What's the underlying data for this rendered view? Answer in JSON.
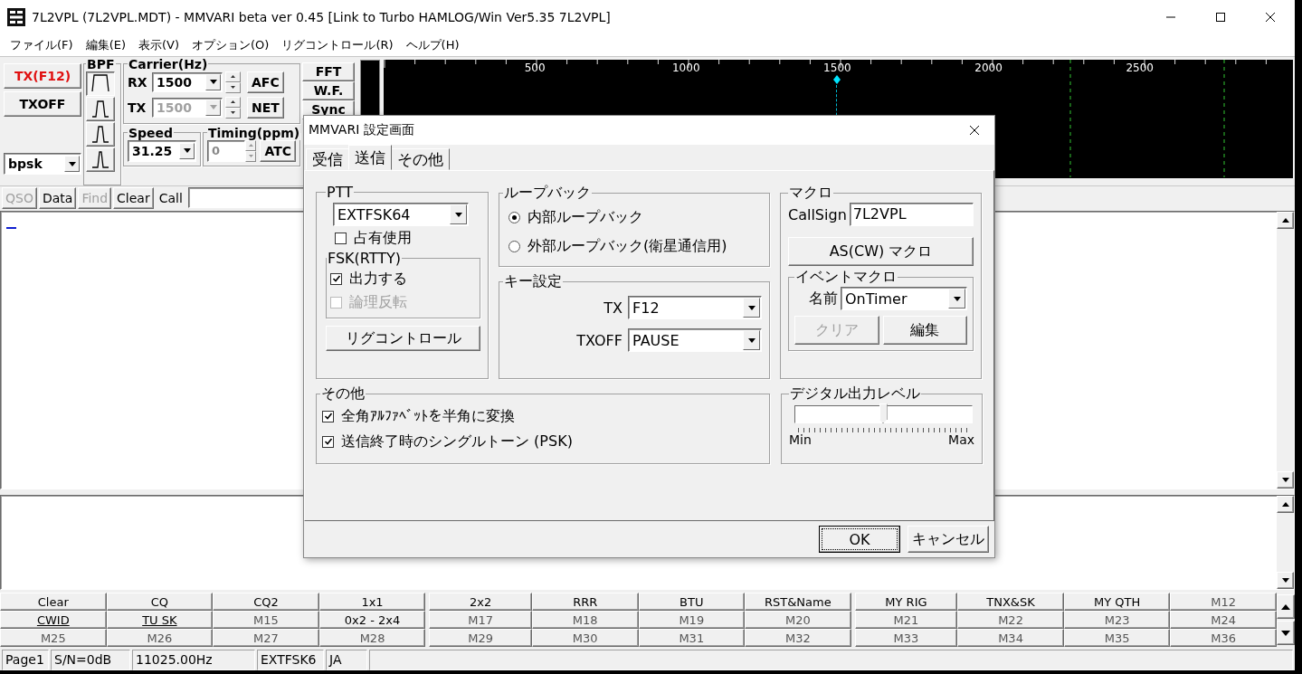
{
  "window": {
    "title": "7L2VPL (7L2VPL.MDT) - MMVARI beta ver 0.45 [Link to Turbo HAMLOG/Win Ver5.35 7L2VPL]"
  },
  "menu": [
    "ファイル(F)",
    "編集(E)",
    "表示(V)",
    "オプション(O)",
    "リグコントロール(R)",
    "ヘルプ(H)"
  ],
  "transmit": {
    "tx_button": "TX(F12)",
    "txoff_button": "TXOFF",
    "mode": "bpsk"
  },
  "bpf": {
    "label": "BPF",
    "filters": [
      {
        "selected": true
      },
      {
        "selected": false
      },
      {
        "selected": false
      },
      {
        "selected": false
      }
    ]
  },
  "carrier": {
    "label": "Carrier(Hz)",
    "rows": [
      {
        "label": "RX",
        "value": "1500",
        "disabled": false,
        "button": "AFC"
      },
      {
        "label": "TX",
        "value": "1500",
        "disabled": true,
        "button": "NET"
      }
    ]
  },
  "speed": {
    "label": "Speed",
    "value": "31.25"
  },
  "timing": {
    "label": "Timing(ppm)",
    "value": "0",
    "button": "ATC"
  },
  "view_buttons": [
    "FFT",
    "W.F.",
    "Sync"
  ],
  "spectrum": {
    "scale": [
      {
        "label": "500",
        "carrier": false
      },
      {
        "label": "1000",
        "carrier": false
      },
      {
        "label": "1500",
        "carrier": true
      },
      {
        "label": "2000",
        "carrier": false
      },
      {
        "label": "2500",
        "carrier": false
      }
    ]
  },
  "command_bar": {
    "buttons": [
      {
        "label": "QSO",
        "disabled": true
      },
      {
        "label": "Data",
        "disabled": false
      },
      {
        "label": "Find",
        "disabled": true
      },
      {
        "label": "Clear",
        "disabled": false
      }
    ],
    "call_label": "Call"
  },
  "macros": [
    {
      "label": "Clear",
      "assigned": true,
      "underlined": false
    },
    {
      "label": "CQ",
      "assigned": true,
      "underlined": false
    },
    {
      "label": "CQ2",
      "assigned": true,
      "underlined": false
    },
    {
      "label": "1x1",
      "assigned": true,
      "underlined": false
    },
    {
      "label": "2x2",
      "assigned": true,
      "underlined": false
    },
    {
      "label": "RRR",
      "assigned": true,
      "underlined": false
    },
    {
      "label": "BTU",
      "assigned": true,
      "underlined": false
    },
    {
      "label": "RST&Name",
      "assigned": true,
      "underlined": false
    },
    {
      "label": "MY RIG",
      "assigned": true,
      "underlined": false
    },
    {
      "label": "TNX&SK",
      "assigned": true,
      "underlined": false
    },
    {
      "label": "MY QTH",
      "assigned": true,
      "underlined": false
    },
    {
      "label": "M12",
      "assigned": false,
      "underlined": false
    },
    {
      "label": "CWID",
      "assigned": true,
      "underlined": true
    },
    {
      "label": "TU SK",
      "assigned": true,
      "underlined": true
    },
    {
      "label": "M15",
      "assigned": false,
      "underlined": false
    },
    {
      "label": "0x2 - 2x4",
      "assigned": true,
      "underlined": false
    },
    {
      "label": "M17",
      "assigned": false,
      "underlined": false
    },
    {
      "label": "M18",
      "assigned": false,
      "underlined": false
    },
    {
      "label": "M19",
      "assigned": false,
      "underlined": false
    },
    {
      "label": "M20",
      "assigned": false,
      "underlined": false
    },
    {
      "label": "M21",
      "assigned": false,
      "underlined": false
    },
    {
      "label": "M22",
      "assigned": false,
      "underlined": false
    },
    {
      "label": "M23",
      "assigned": false,
      "underlined": false
    },
    {
      "label": "M24",
      "assigned": false,
      "underlined": false
    },
    {
      "label": "M25",
      "assigned": false,
      "underlined": false
    },
    {
      "label": "M26",
      "assigned": false,
      "underlined": false
    },
    {
      "label": "M27",
      "assigned": false,
      "underlined": false
    },
    {
      "label": "M28",
      "assigned": false,
      "underlined": false
    },
    {
      "label": "M29",
      "assigned": false,
      "underlined": false
    },
    {
      "label": "M30",
      "assigned": false,
      "underlined": false
    },
    {
      "label": "M31",
      "assigned": false,
      "underlined": false
    },
    {
      "label": "M32",
      "assigned": false,
      "underlined": false
    },
    {
      "label": "M33",
      "assigned": false,
      "underlined": false
    },
    {
      "label": "M34",
      "assigned": false,
      "underlined": false
    },
    {
      "label": "M35",
      "assigned": false,
      "underlined": false
    },
    {
      "label": "M36",
      "assigned": false,
      "underlined": false
    }
  ],
  "status_bar": [
    "Page1",
    "S/N=0dB",
    "11025.00Hz",
    "EXTFSK6",
    "JA"
  ],
  "dialog": {
    "title": "MMVARI 設定画面",
    "tabs": [
      {
        "label": "受信",
        "selected": false
      },
      {
        "label": "送信",
        "selected": true
      },
      {
        "label": "その他",
        "selected": false
      }
    ],
    "ptt": {
      "label": "PTT",
      "port": "EXTFSK64",
      "exclusive": {
        "label": "占有使用",
        "checked": false
      },
      "fsk": {
        "label": "FSK(RTTY)",
        "options": [
          {
            "label": "出力する",
            "checked": true,
            "disabled": false
          },
          {
            "label": "論理反転",
            "checked": false,
            "disabled": true
          }
        ]
      },
      "rig_button": "リグコントロール"
    },
    "loopback": {
      "label": "ループバック",
      "options": [
        {
          "label": "内部ループバック",
          "selected": true
        },
        {
          "label": "外部ループバック(衛星通信用)",
          "selected": false
        }
      ]
    },
    "keys": {
      "label": "キー設定",
      "rows": [
        {
          "label": "TX",
          "value": "F12"
        },
        {
          "label": "TXOFF",
          "value": "PAUSE"
        }
      ]
    },
    "macro": {
      "label": "マクロ",
      "callsign_label": "CallSign",
      "callsign": "7L2VPL",
      "as_button": "AS(CW) マクロ",
      "event": {
        "label": "イベントマクロ",
        "name_label": "名前",
        "name": "OnTimer",
        "buttons": [
          {
            "label": "クリア",
            "disabled": true
          },
          {
            "label": "編集",
            "disabled": false
          }
        ]
      }
    },
    "other": {
      "label": "その他",
      "options": [
        {
          "label": "全角ｱﾙﾌｧﾍﾞｯﾄを半角に変換",
          "checked": true
        },
        {
          "label": "送信終了時のシングルトーン (PSK)",
          "checked": true
        }
      ]
    },
    "output_level": {
      "label": "デジタル出力レベル",
      "level": 0.5,
      "min": "Min",
      "max": "Max"
    },
    "buttons": [
      {
        "label": "OK",
        "default": true
      },
      {
        "label": "キャンセル",
        "default": false
      }
    ]
  }
}
